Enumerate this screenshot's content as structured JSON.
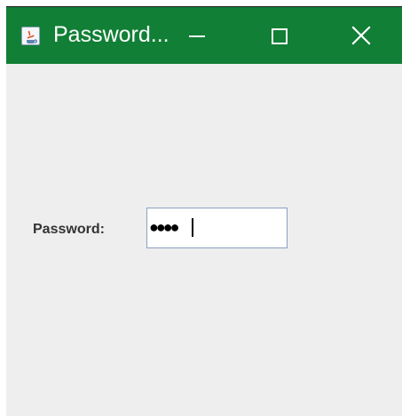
{
  "window": {
    "title": "Password...",
    "background_color": "#eeeeee",
    "titlebar_color": "#117f35",
    "icons": {
      "app": "java-app-icon",
      "minimize": "minimize-icon",
      "maximize": "maximize-icon",
      "close": "close-icon"
    }
  },
  "form": {
    "password_label": "Password:",
    "password_mask": "●●●●",
    "password_length": 4
  }
}
